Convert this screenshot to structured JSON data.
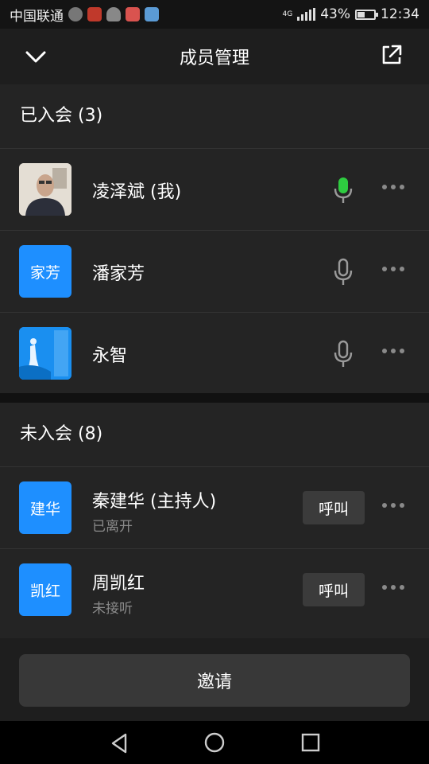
{
  "status_bar": {
    "carrier": "中国联通",
    "network": "4G",
    "battery": "43%",
    "battery_level": 0.43,
    "time": "12:34"
  },
  "header": {
    "title": "成员管理",
    "back_icon": "chevron-down-icon",
    "share_icon": "share-out-icon"
  },
  "joined": {
    "title": "已入会 (3)",
    "members": [
      {
        "name": "凌泽斌 (我)",
        "avatar_type": "photo",
        "mic_state": "active",
        "mic_color": "#2ecc40"
      },
      {
        "name": "潘家芳",
        "avatar_text": "家芳",
        "mic_state": "muted"
      },
      {
        "name": "永智",
        "avatar_type": "image",
        "mic_state": "muted"
      }
    ]
  },
  "not_joined": {
    "title": "未入会 (8)",
    "members": [
      {
        "name": "秦建华 (主持人)",
        "avatar_text": "建华",
        "status": "已离开",
        "action": "呼叫"
      },
      {
        "name": "周凯红",
        "avatar_text": "凯红",
        "status": "未接听",
        "action": "呼叫"
      }
    ]
  },
  "invite_button": "邀请",
  "colors": {
    "accent_blue": "#1e8fff",
    "background": "#1e1e1e",
    "row_background": "#242424"
  }
}
